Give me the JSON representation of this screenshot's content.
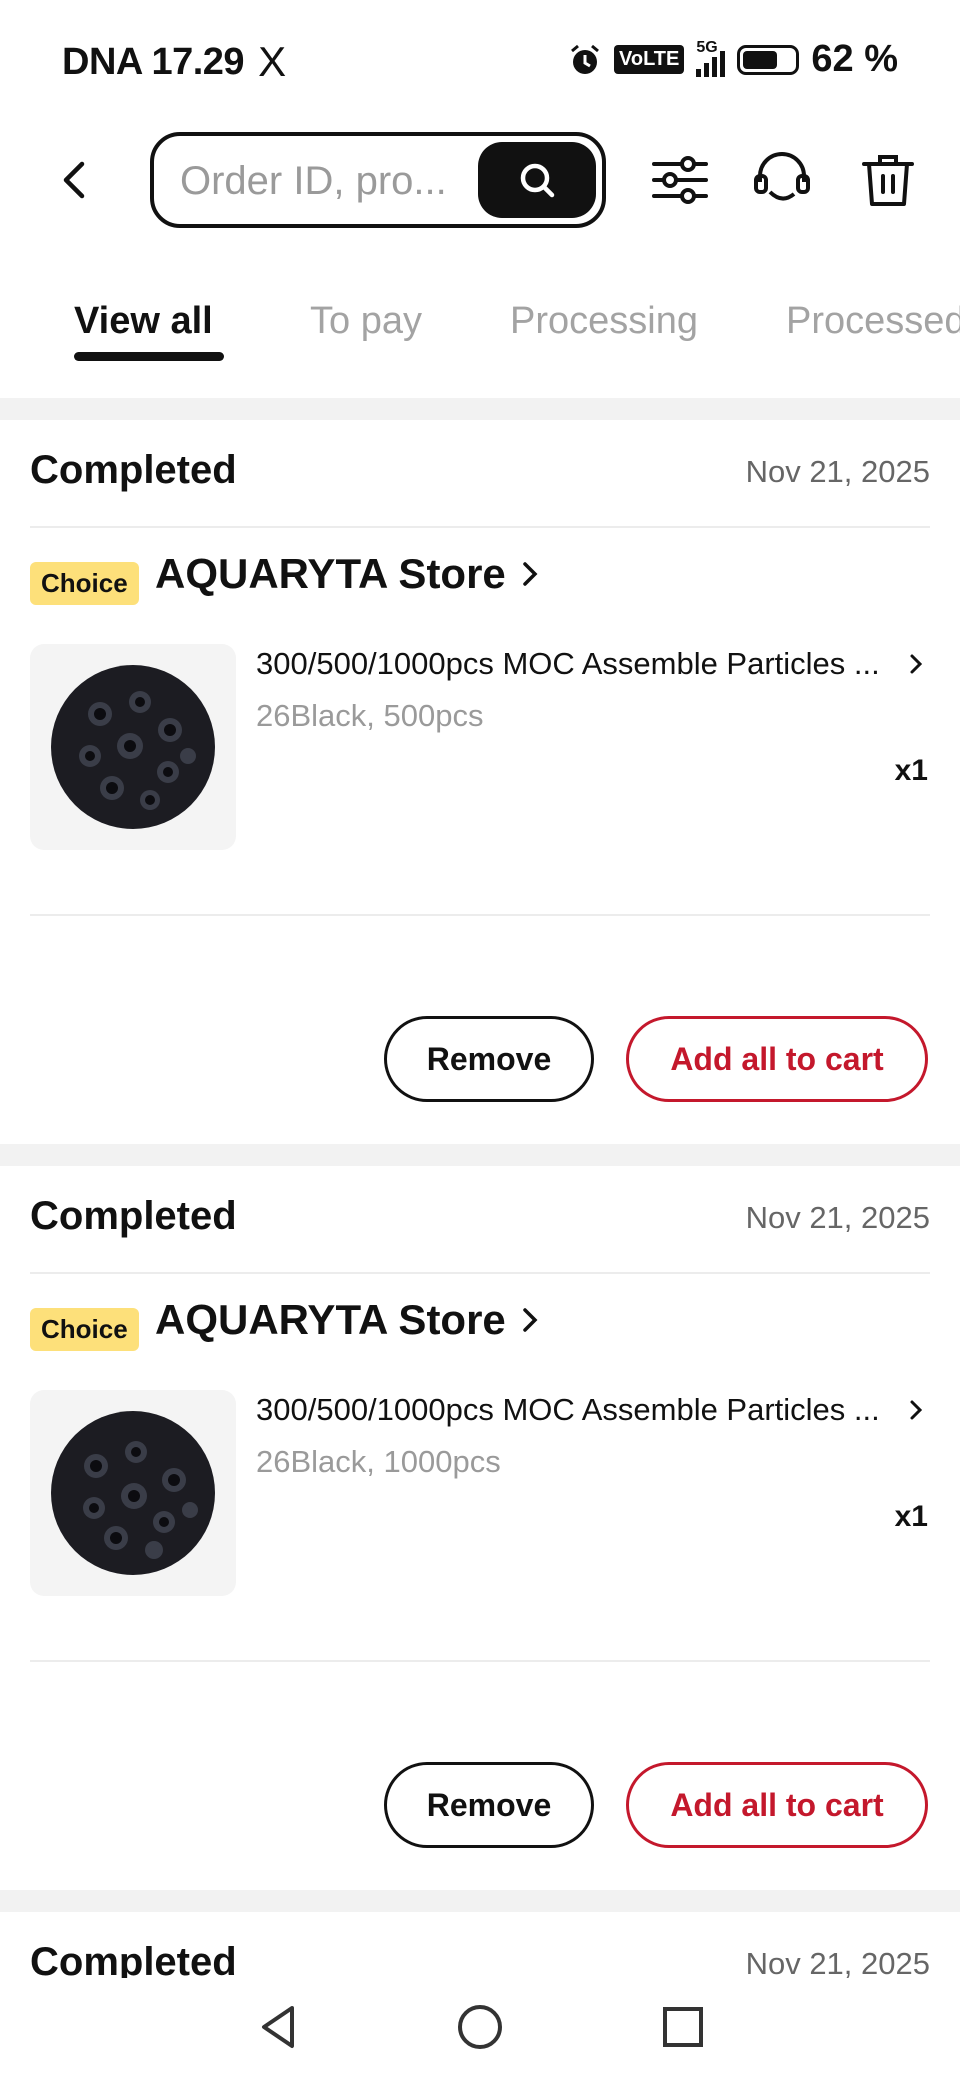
{
  "status_bar": {
    "carrier_time": "DNA 17.29",
    "app_glyph": "X",
    "volte": "VoLTE",
    "network": "5G",
    "battery": "62 %"
  },
  "header": {
    "search_placeholder": "Order ID, pro..."
  },
  "tabs": [
    "View all",
    "To pay",
    "Processing",
    "Processed"
  ],
  "active_tab": "View all",
  "orders": [
    {
      "status": "Completed",
      "date": "Nov 21, 2025",
      "badge": "Choice",
      "store": "AQUARYTA Store",
      "title": "300/500/1000pcs MOC Assemble Particles ...",
      "variant": "26Black, 500pcs",
      "qty": "x1",
      "remove_label": "Remove",
      "add_label": "Add all to cart"
    },
    {
      "status": "Completed",
      "date": "Nov 21, 2025",
      "badge": "Choice",
      "store": "AQUARYTA Store",
      "title": "300/500/1000pcs MOC Assemble Particles ...",
      "variant": "26Black, 1000pcs",
      "qty": "x1",
      "remove_label": "Remove",
      "add_label": "Add all to cart"
    },
    {
      "status": "Completed",
      "date": "Nov 21, 2025"
    }
  ],
  "colors": {
    "accent_red": "#c4182c",
    "choice_yellow": "#fde07a",
    "text_dark": "#111111",
    "text_muted": "#9a9a9a"
  }
}
